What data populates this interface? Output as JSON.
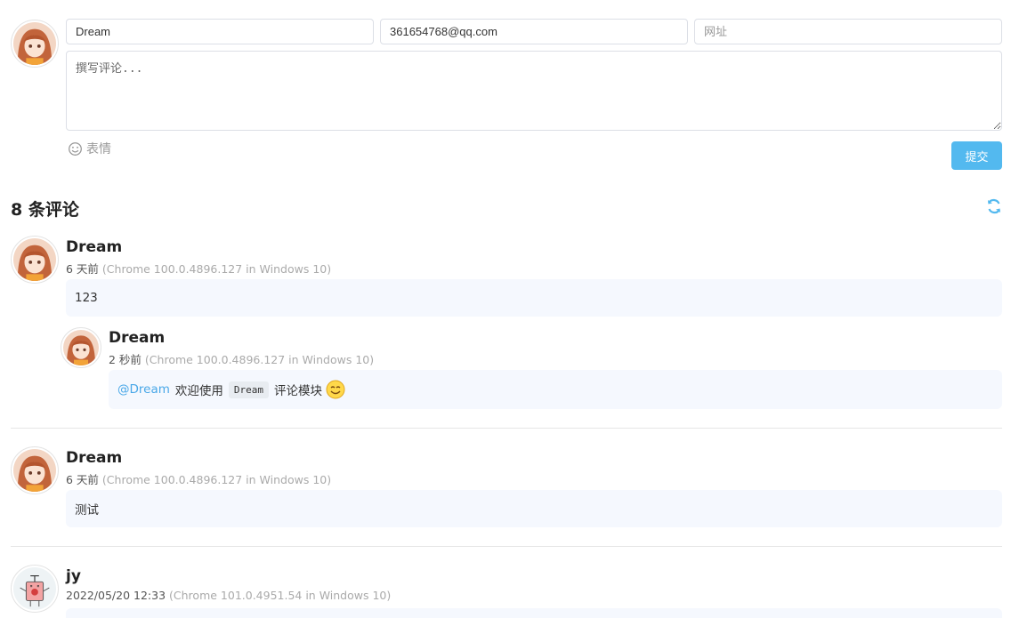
{
  "form": {
    "nick_value": "Dream",
    "email_value": "361654768@qq.com",
    "url_placeholder": "网址",
    "comment_placeholder": "撰写评论...",
    "emoji_label": "表情",
    "submit_label": "提交"
  },
  "comments_header": {
    "count_label": "8 条评论"
  },
  "comments": [
    {
      "nick": "Dream",
      "time": "6 天前",
      "ua": "(Chrome 100.0.4896.127 in Windows 10)",
      "content": "123",
      "reply": {
        "nick": "Dream",
        "time": "2 秒前",
        "ua": "(Chrome 100.0.4896.127 in Windows 10)",
        "mention": "@Dream",
        "text_before": "欢迎使用",
        "code": "Dream",
        "text_after": "评论模块"
      }
    },
    {
      "nick": "Dream",
      "time": "6 天前",
      "ua": "(Chrome 100.0.4896.127 in Windows 10)",
      "content": "测试"
    },
    {
      "nick": "jy",
      "time": "2022/05/20 12:33",
      "ua": "(Chrome 101.0.4951.54 in Windows 10)"
    }
  ],
  "colors": {
    "accent": "#53b9ef",
    "bubble_bg": "#f5f8fe",
    "divider": "#e6e6e6"
  }
}
